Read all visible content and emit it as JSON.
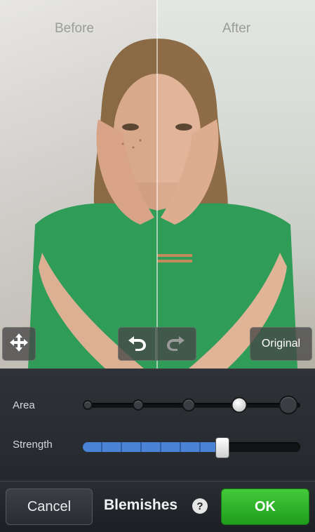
{
  "compare": {
    "before_label": "Before",
    "after_label": "After"
  },
  "photo_controls": {
    "move_icon": "move-arrows-icon",
    "undo_icon": "undo-icon",
    "redo_icon": "redo-icon",
    "original_label": "Original"
  },
  "adjustments": {
    "area": {
      "label": "Area",
      "levels": 5,
      "selected_level": 4
    },
    "strength": {
      "label": "Strength",
      "value_fraction": 0.64,
      "fill_color": "#4a82d6"
    }
  },
  "toolbar": {
    "cancel_label": "Cancel",
    "title": "Blemishes",
    "help_icon": "help-icon",
    "help_glyph": "?",
    "ok_label": "OK",
    "ok_color": "#2fb52a"
  }
}
